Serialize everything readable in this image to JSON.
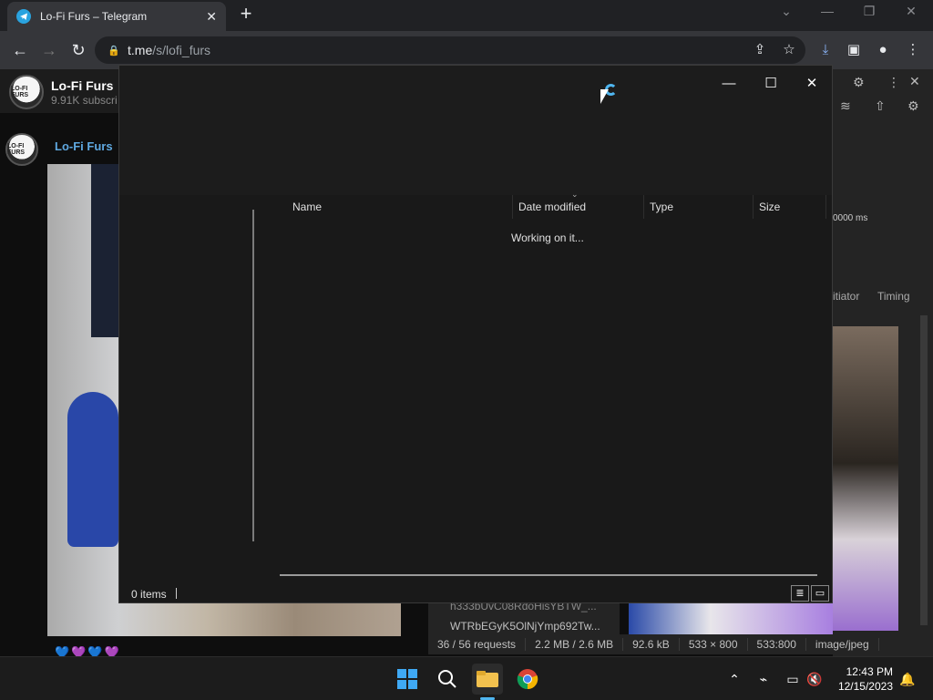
{
  "browser": {
    "tab_title": "Lo-Fi Furs – Telegram",
    "url_host": "t.me",
    "url_path": "/s/lofi_furs"
  },
  "telegram": {
    "channel_name": "Lo-Fi Furs",
    "subscribers": "9.91K subscri",
    "post_author": "Lo-Fi Furs",
    "avatar_text": "LO-FI FURS",
    "reactions": "💙💜💙💜"
  },
  "devtools": {
    "time_label": "0000 ms",
    "tab_initiator": "itiator",
    "tab_timing": "Timing",
    "requests": "36 / 56 requests",
    "transferred": "2.2 MB / 2.6 MB",
    "size": "92.6 kB",
    "dims": "533 × 800",
    "ratio": "533:800",
    "mime": "image/jpeg",
    "row1": "h333bUvC08RdoHisYBTW_...",
    "row2": "WTRbEGyK5OlNjYmp692Tw..."
  },
  "explorer": {
    "columns": [
      "Name",
      "Date modified",
      "Type",
      "Size"
    ],
    "working_text": "Working on it...",
    "status_items": "0 items"
  },
  "taskbar": {
    "time": "12:43 PM",
    "date": "12/15/2023"
  },
  "colors": {
    "accent_blue": "#4fb6f0",
    "telegram_blue": "#2aa3df",
    "channel_link": "#5fa8e0"
  }
}
